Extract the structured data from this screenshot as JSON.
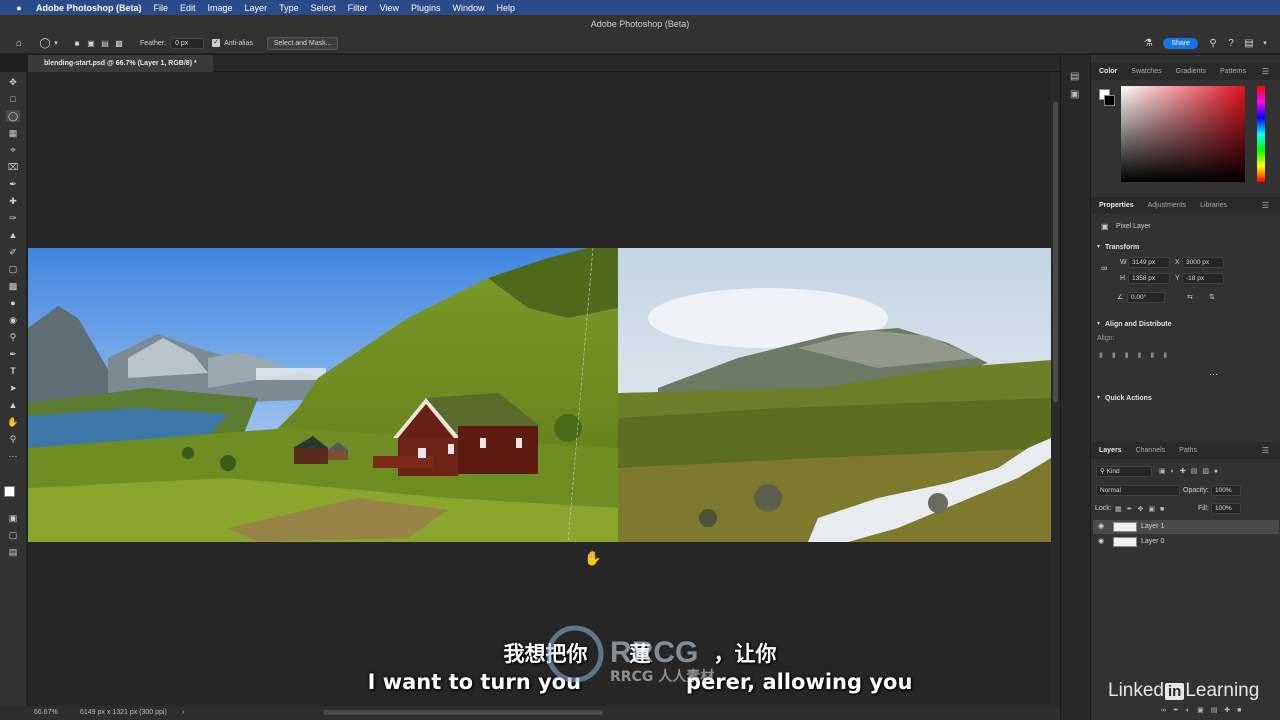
{
  "menubar": {
    "apple": "",
    "app_name": "Adobe Photoshop (Beta)",
    "items": [
      "File",
      "Edit",
      "Image",
      "Layer",
      "Type",
      "Select",
      "Filter",
      "View",
      "Plugins",
      "Window",
      "Help"
    ]
  },
  "window_title": "Adobe Photoshop (Beta)",
  "options_bar": {
    "feather_label": "Feather:",
    "feather_value": "0 px",
    "antialias_label": "Anti-alias",
    "antialias_checked": true,
    "select_mask_label": "Select and Mask...",
    "share_label": "Share"
  },
  "document": {
    "tab_title": "blending-start.psd @ 66.7% (Layer 1, RGB/8) *",
    "zoom": "66.67%",
    "doc_info": "6149 px x 1321 px (300 ppi)"
  },
  "panels": {
    "color_tabs": [
      "Color",
      "Swatches",
      "Gradients",
      "Patterns"
    ],
    "properties_tabs": [
      "Properties",
      "Adjustments",
      "Libraries"
    ],
    "pixel_layer_label": "Pixel Layer",
    "transform": {
      "title": "Transform",
      "w_label": "W",
      "w_value": "3149 px",
      "x_label": "X",
      "x_value": "3000 px",
      "h_label": "H",
      "h_value": "1358 px",
      "y_label": "Y",
      "y_value": "-18 px",
      "angle_value": "0.00°"
    },
    "align": {
      "title": "Align and Distribute",
      "align_label": "Align:"
    },
    "quick_actions": "Quick Actions",
    "layers_tabs": [
      "Layers",
      "Channels",
      "Paths"
    ],
    "layers": {
      "kind_label": "Kind",
      "blend_mode": "Normal",
      "opacity_label": "Opacity:",
      "opacity_value": "100%",
      "lock_label": "Lock:",
      "fill_label": "Fill:",
      "fill_value": "100%",
      "items": [
        {
          "name": "Layer 1",
          "selected": true
        },
        {
          "name": "Layer 0",
          "selected": false
        }
      ]
    }
  },
  "subtitles": {
    "chinese": "我想把你",
    "chinese_tail": "蓮",
    "chinese_end": "，让你",
    "english": "I want to turn you",
    "english_end": "perer, allowing you"
  },
  "watermark": "RRCG 人人素材",
  "brand": {
    "linked": "Linked",
    "in": "in",
    "learning": "Learning"
  }
}
